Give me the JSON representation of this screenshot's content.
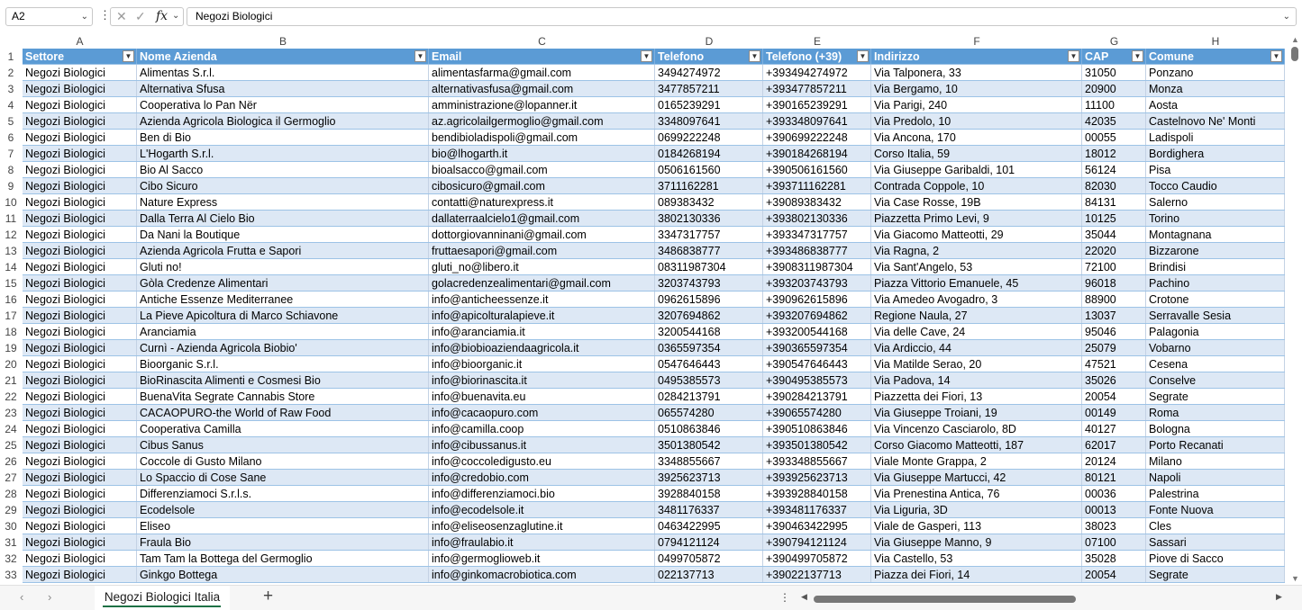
{
  "name_box": "A2",
  "formula": "Negozi Biologici",
  "column_letters": [
    "A",
    "B",
    "C",
    "D",
    "E",
    "F",
    "G",
    "H"
  ],
  "headers": [
    "Settore",
    "Nome Azienda",
    "Email",
    "Telefono",
    "Telefono (+39)",
    "Indirizzo",
    "CAP",
    "Comune"
  ],
  "first_row_number": 1,
  "rows": [
    [
      "Negozi Biologici",
      "Alimentas S.r.l.",
      "alimentasfarma@gmail.com",
      "3494274972",
      "+393494274972",
      "Via Talponera, 33",
      "31050",
      "Ponzano"
    ],
    [
      "Negozi Biologici",
      "Alternativa Sfusa",
      "alternativasfusa@gmail.com",
      "3477857211",
      "+393477857211",
      "Via Bergamo, 10",
      "20900",
      "Monza"
    ],
    [
      "Negozi Biologici",
      "Cooperativa lo Pan Nër",
      "amministrazione@lopanner.it",
      "0165239291",
      "+390165239291",
      "Via Parigi, 240",
      "11100",
      "Aosta"
    ],
    [
      "Negozi Biologici",
      "Azienda Agricola Biologica il Germoglio",
      "az.agricolailgermoglio@gmail.com",
      "3348097641",
      "+393348097641",
      "Via Predolo, 10",
      "42035",
      "Castelnovo Ne' Monti"
    ],
    [
      "Negozi Biologici",
      "Ben di Bio",
      "bendibioladispoli@gmail.com",
      "0699222248",
      "+390699222248",
      "Via Ancona, 170",
      "00055",
      "Ladispoli"
    ],
    [
      "Negozi Biologici",
      "L'Hogarth S.r.l.",
      "bio@lhogarth.it",
      "0184268194",
      "+390184268194",
      "Corso Italia, 59",
      "18012",
      "Bordighera"
    ],
    [
      "Negozi Biologici",
      "Bio Al Sacco",
      "bioalsacco@gmail.com",
      "0506161560",
      "+390506161560",
      "Via Giuseppe Garibaldi, 101",
      "56124",
      "Pisa"
    ],
    [
      "Negozi Biologici",
      "Cibo Sicuro",
      "cibosicuro@gmail.com",
      "3711162281",
      "+393711162281",
      "Contrada Coppole, 10",
      "82030",
      "Tocco Caudio"
    ],
    [
      "Negozi Biologici",
      "Nature Express",
      "contatti@naturexpress.it",
      "089383432",
      "+39089383432",
      "Via Case Rosse, 19B",
      "84131",
      "Salerno"
    ],
    [
      "Negozi Biologici",
      "Dalla Terra Al Cielo Bio",
      "dallaterraalcielo1@gmail.com",
      "3802130336",
      "+393802130336",
      "Piazzetta Primo Levi, 9",
      "10125",
      "Torino"
    ],
    [
      "Negozi Biologici",
      "Da Nani la Boutique",
      "dottorgiovanninani@gmail.com",
      "3347317757",
      "+393347317757",
      "Via Giacomo Matteotti, 29",
      "35044",
      "Montagnana"
    ],
    [
      "Negozi Biologici",
      "Azienda Agricola Frutta e Sapori",
      "fruttaesapori@gmail.com",
      "3486838777",
      "+393486838777",
      "Via Ragna, 2",
      "22020",
      "Bizzarone"
    ],
    [
      "Negozi Biologici",
      "Gluti no!",
      "gluti_no@libero.it",
      "08311987304",
      "+3908311987304",
      "Via Sant'Angelo, 53",
      "72100",
      "Brindisi"
    ],
    [
      "Negozi Biologici",
      "Gòla Credenze Alimentari",
      "golacredenzealimentari@gmail.com",
      "3203743793",
      "+393203743793",
      "Piazza Vittorio Emanuele, 45",
      "96018",
      "Pachino"
    ],
    [
      "Negozi Biologici",
      "Antiche Essenze Mediterranee",
      "info@anticheessenze.it",
      "0962615896",
      "+390962615896",
      "Via Amedeo Avogadro, 3",
      "88900",
      "Crotone"
    ],
    [
      "Negozi Biologici",
      "La Pieve Apicoltura di Marco Schiavone",
      "info@apicolturalapieve.it",
      "3207694862",
      "+393207694862",
      "Regione Naula, 27",
      "13037",
      "Serravalle Sesia"
    ],
    [
      "Negozi Biologici",
      "Aranciamia",
      "info@aranciamia.it",
      "3200544168",
      "+393200544168",
      "Via delle Cave, 24",
      "95046",
      "Palagonia"
    ],
    [
      "Negozi Biologici",
      "Curnì - Azienda Agricola Biobio'",
      "info@biobioaziendaagricola.it",
      "0365597354",
      "+390365597354",
      "Via Ardiccio, 44",
      "25079",
      "Vobarno"
    ],
    [
      "Negozi Biologici",
      "Bioorganic S.r.l.",
      "info@bioorganic.it",
      "0547646443",
      "+390547646443",
      "Via Matilde Serao, 20",
      "47521",
      "Cesena"
    ],
    [
      "Negozi Biologici",
      "BioRinascita Alimenti e Cosmesi Bio",
      "info@biorinascita.it",
      "0495385573",
      "+390495385573",
      "Via Padova, 14",
      "35026",
      "Conselve"
    ],
    [
      "Negozi Biologici",
      "BuenaVita Segrate Cannabis Store",
      "info@buenavita.eu",
      "0284213791",
      "+390284213791",
      "Piazzetta dei Fiori, 13",
      "20054",
      "Segrate"
    ],
    [
      "Negozi Biologici",
      "CACAOPURO-the World of Raw Food",
      "info@cacaopuro.com",
      "065574280",
      "+39065574280",
      "Via Giuseppe Troiani, 19",
      "00149",
      "Roma"
    ],
    [
      "Negozi Biologici",
      "Cooperativa Camilla",
      "info@camilla.coop",
      "0510863846",
      "+390510863846",
      "Via Vincenzo Casciarolo, 8D",
      "40127",
      "Bologna"
    ],
    [
      "Negozi Biologici",
      "Cibus Sanus",
      "info@cibussanus.it",
      "3501380542",
      "+393501380542",
      "Corso Giacomo Matteotti, 187",
      "62017",
      "Porto Recanati"
    ],
    [
      "Negozi Biologici",
      "Coccole di Gusto Milano",
      "info@coccoledigusto.eu",
      "3348855667",
      "+393348855667",
      "Viale Monte Grappa, 2",
      "20124",
      "Milano"
    ],
    [
      "Negozi Biologici",
      "Lo Spaccio di Cose Sane",
      "info@credobio.com",
      "3925623713",
      "+393925623713",
      "Via Giuseppe Martucci, 42",
      "80121",
      "Napoli"
    ],
    [
      "Negozi Biologici",
      "Differenziamoci S.r.l.s.",
      "info@differenziamoci.bio",
      "3928840158",
      "+393928840158",
      "Via Prenestina Antica, 76",
      "00036",
      "Palestrina"
    ],
    [
      "Negozi Biologici",
      "Ecodelsole",
      "info@ecodelsole.it",
      "3481176337",
      "+393481176337",
      "Via Liguria, 3D",
      "00013",
      "Fonte Nuova"
    ],
    [
      "Negozi Biologici",
      "Eliseo",
      "info@eliseosenzaglutine.it",
      "0463422995",
      "+390463422995",
      "Viale de Gasperi, 113",
      "38023",
      "Cles"
    ],
    [
      "Negozi Biologici",
      "Fraula Bio",
      "info@fraulabio.it",
      "0794121124",
      "+390794121124",
      "Via Giuseppe Manno, 9",
      "07100",
      "Sassari"
    ],
    [
      "Negozi Biologici",
      "Tam Tam la Bottega del Germoglio",
      "info@germoglioweb.it",
      "0499705872",
      "+390499705872",
      "Via Castello, 53",
      "35028",
      "Piove di Sacco"
    ],
    [
      "Negozi Biologici",
      "Ginkgo Bottega",
      "info@ginkomacrobiotica.com",
      "022137713",
      "+39022137713",
      "Piazza dei Fiori, 14",
      "20054",
      "Segrate"
    ]
  ],
  "sheet_tab": "Negozi Biologici Italia",
  "colors": {
    "header_bg": "#5b9bd5",
    "band_bg": "#dde8f5",
    "sheet_accent": "#1e7145"
  },
  "icons": [
    "cancel-icon",
    "enter-icon",
    "function-icon",
    "add-sheet-icon",
    "dropdown-icon",
    "filter-icon"
  ]
}
